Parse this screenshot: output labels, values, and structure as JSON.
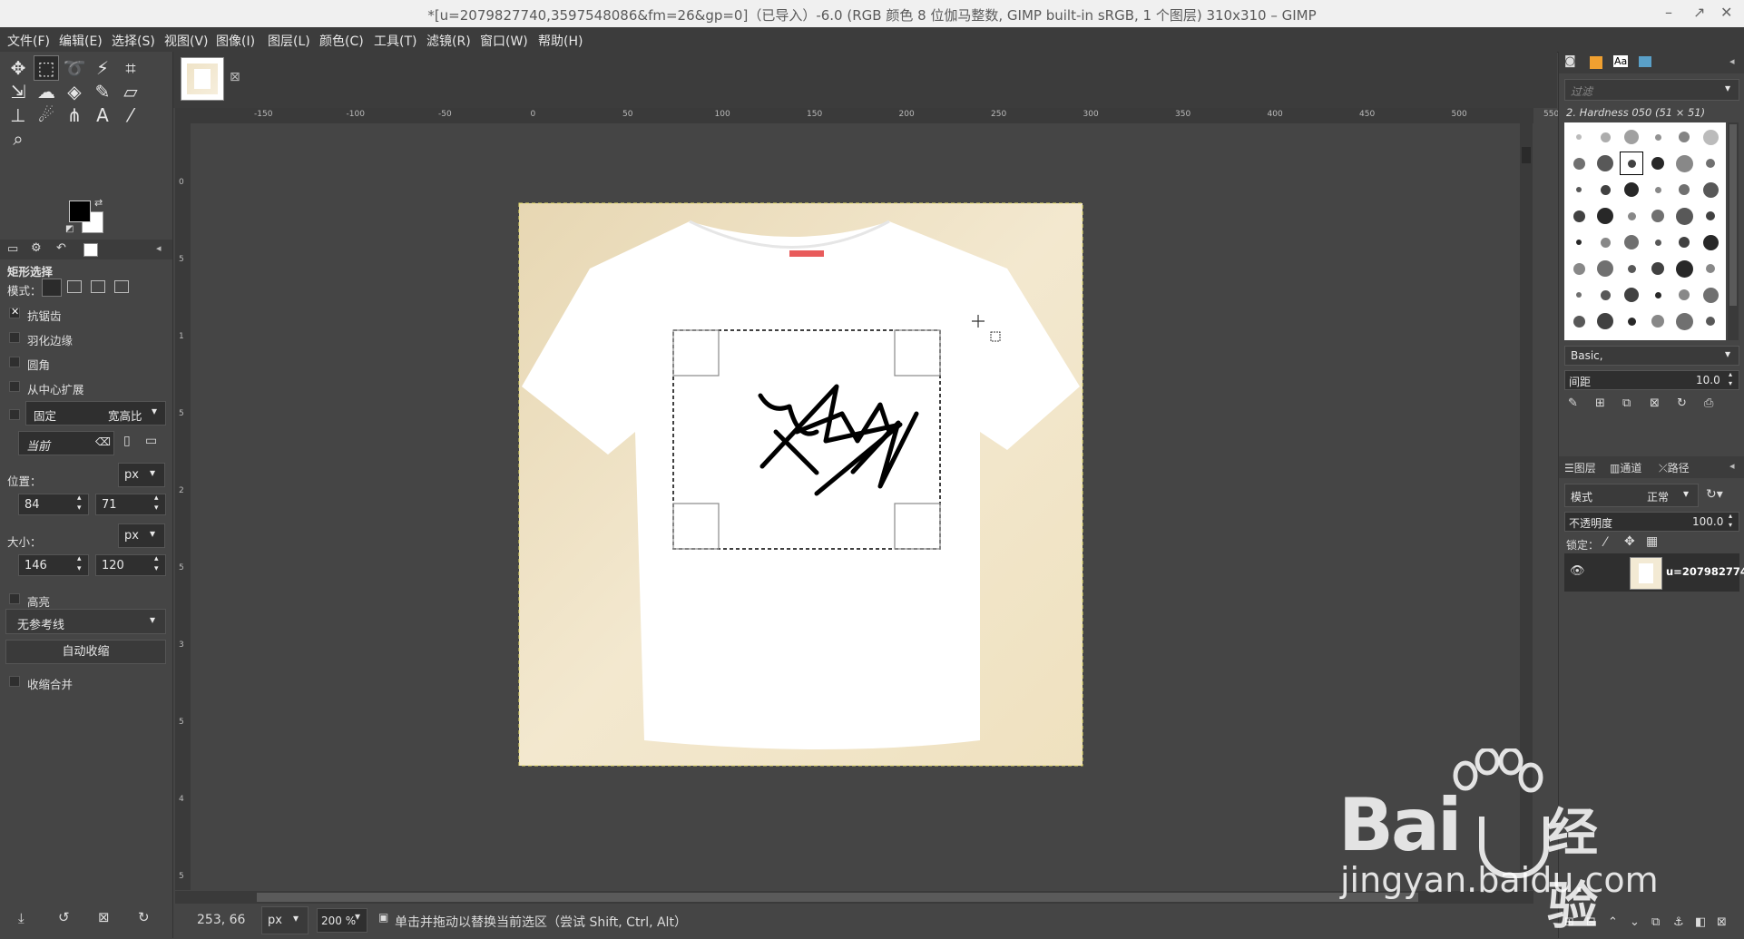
{
  "window": {
    "title": "*[u=2079827740,3597548086&fm=26&gp=0]（已导入）-6.0 (RGB 颜色 8 位伽马整数, GIMP built-in sRGB, 1 个图层) 310x310 – GIMP",
    "controls": [
      "–",
      "↗",
      "✕"
    ]
  },
  "menu": [
    "文件(F)",
    "编辑(E)",
    "选择(S)",
    "视图(V)",
    "图像(I)",
    "图层(L)",
    "颜色(C)",
    "工具(T)",
    "滤镜(R)",
    "窗口(W)",
    "帮助(H)"
  ],
  "toolbox": {
    "tools": [
      {
        "name": "move-tool-icon",
        "glyph": "✥"
      },
      {
        "name": "rect-select-tool-icon",
        "glyph": "⬚",
        "selected": true
      },
      {
        "name": "lasso-tool-icon",
        "glyph": "➰"
      },
      {
        "name": "fuzzy-select-tool-icon",
        "glyph": "⚡"
      },
      {
        "name": "crop-tool-icon",
        "glyph": "⌗"
      },
      {
        "name": "transform-tool-icon",
        "glyph": "⇲"
      },
      {
        "name": "warp-tool-icon",
        "glyph": "☁"
      },
      {
        "name": "bucket-fill-tool-icon",
        "glyph": "◈"
      },
      {
        "name": "paintbrush-tool-icon",
        "glyph": "✎"
      },
      {
        "name": "eraser-tool-icon",
        "glyph": "▱"
      },
      {
        "name": "clone-tool-icon",
        "glyph": "⊥"
      },
      {
        "name": "smudge-tool-icon",
        "glyph": "☄"
      },
      {
        "name": "paths-tool-icon",
        "glyph": "⋔"
      },
      {
        "name": "text-tool-icon",
        "glyph": "A"
      },
      {
        "name": "color-picker-tool-icon",
        "glyph": "⁄"
      },
      {
        "name": "zoom-tool-icon",
        "glyph": "⌕"
      }
    ]
  },
  "tool_options": {
    "title": "矩形选择",
    "mode_label": "模式：",
    "antialias": "抗锯齿",
    "feather": "羽化边缘",
    "rounded": "圆角",
    "expand_center": "从中心扩展",
    "fixed": "固定",
    "fixed_option": "宽高比",
    "current": "当前",
    "position_label": "位置：",
    "position_unit": "px",
    "pos_x": "84",
    "pos_y": "71",
    "size_label": "大小：",
    "size_unit": "px",
    "size_w": "146",
    "size_h": "120",
    "highlight": "高亮",
    "guides": "无参考线",
    "auto_shrink": "自动收缩",
    "shrink_merged": "收缩合并"
  },
  "ruler_h": [
    "-150",
    "-100",
    "-50",
    "0",
    "50",
    "100",
    "150",
    "200",
    "250",
    "300",
    "350",
    "400",
    "450",
    "500",
    "550"
  ],
  "ruler_v": [
    "0",
    "5",
    "1",
    "5",
    "2",
    "5",
    "3",
    "5",
    "4",
    "5"
  ],
  "statusbar": {
    "coords": "253, 66",
    "unit": "px",
    "zoom": "200 %",
    "message": "单击并拖动以替换当前选区（尝试 Shift, Ctrl, Alt）"
  },
  "brushes": {
    "filter_placeholder": "过滤",
    "current_brush": "2. Hardness 050 (51 × 51)",
    "tag": "Basic,",
    "spacing_label": "间距",
    "spacing_value": "10.0"
  },
  "layers": {
    "tabs": [
      "图层",
      "通道",
      "路径"
    ],
    "mode_label": "模式",
    "mode_value": "正常",
    "opacity_label": "不透明度",
    "opacity_value": "100.0",
    "lock_label": "锁定：",
    "layer_name": "u=207982774"
  },
  "watermark": {
    "brand": "Bai",
    "brand2": "经验",
    "url": "jingyan.baidu.com"
  }
}
